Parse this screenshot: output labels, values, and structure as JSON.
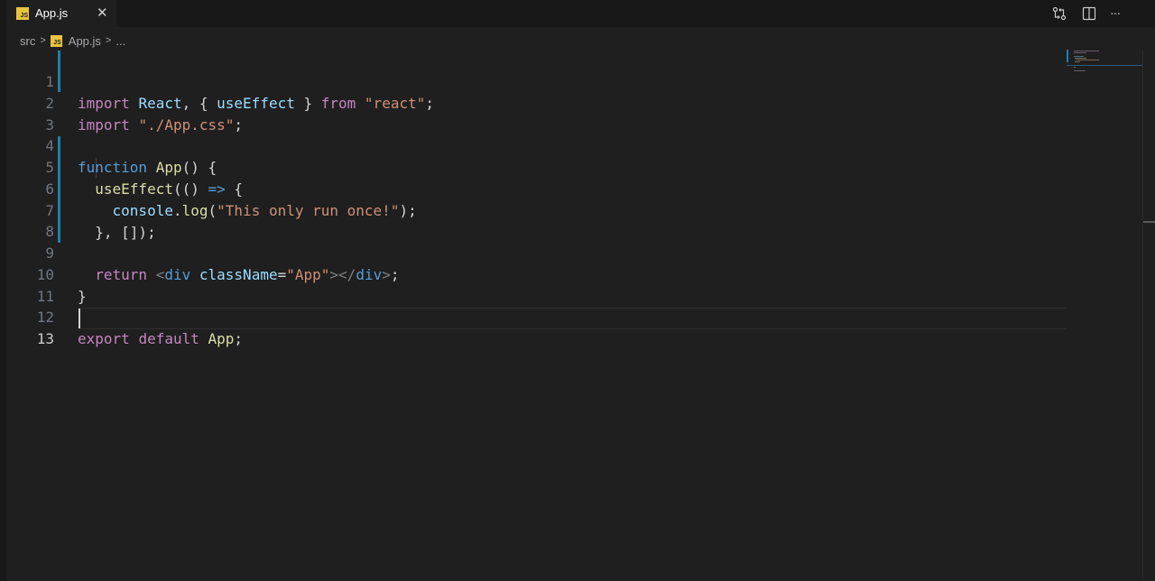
{
  "tab": {
    "label": "App.js",
    "icon": "js-file-icon",
    "badge": "JS",
    "close_glyph": "✕"
  },
  "actions": [
    {
      "name": "open-changes-icon"
    },
    {
      "name": "split-editor-icon"
    },
    {
      "name": "more-actions-icon",
      "glyph": "···"
    }
  ],
  "breadcrumb": {
    "folder": "src",
    "file": "App.js",
    "more": "..."
  },
  "editor": {
    "active_line": 13,
    "lines": [
      {
        "n": "1",
        "text": "import React, { useEffect } from \"react\";"
      },
      {
        "n": "2",
        "text": "import \"./App.css\";"
      },
      {
        "n": "3",
        "text": ""
      },
      {
        "n": "4",
        "text": "function App() {"
      },
      {
        "n": "5",
        "text": "  useEffect(() => {"
      },
      {
        "n": "6",
        "text": "    console.log(\"This only run once!\");"
      },
      {
        "n": "7",
        "text": "  }, []);"
      },
      {
        "n": "8",
        "text": ""
      },
      {
        "n": "9",
        "text": "  return <div className=\"App\"></div>;"
      },
      {
        "n": "10",
        "text": "}"
      },
      {
        "n": "11",
        "text": ""
      },
      {
        "n": "12",
        "text": "export default App;"
      },
      {
        "n": "13",
        "text": ""
      }
    ]
  },
  "colors": {
    "background": "#1f1f1f",
    "accent": "#1b81a8",
    "js_badge": "#e8c43c"
  }
}
